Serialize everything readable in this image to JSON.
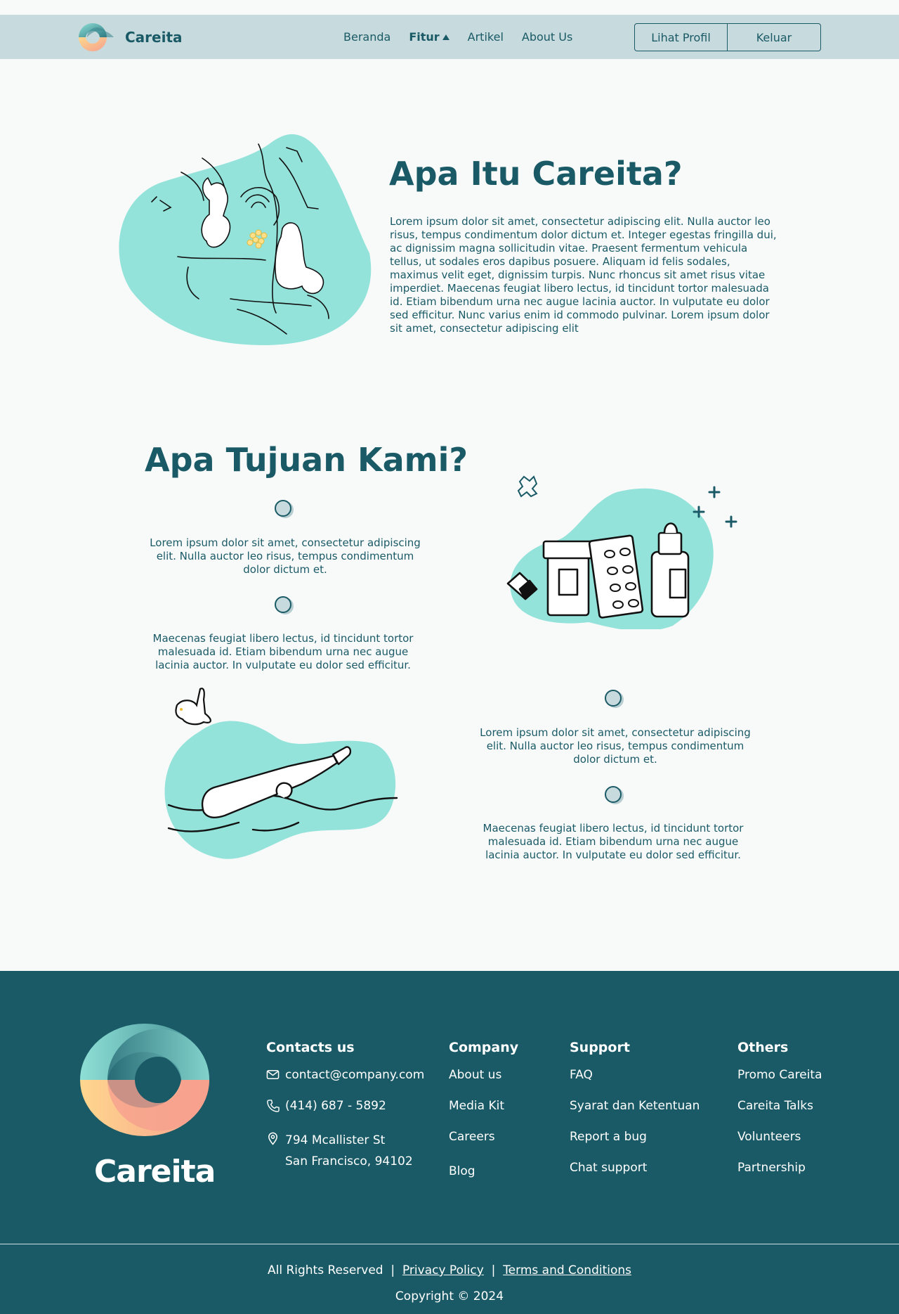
{
  "nav": {
    "brand": "Careita",
    "links": [
      "Beranda",
      "Fitur",
      "Artikel",
      "About Us"
    ],
    "profile_button": "Lihat Profil",
    "logout_button": "Keluar"
  },
  "about": {
    "title": "Apa Itu Careita?",
    "body": "Lorem ipsum dolor sit amet, consectetur adipiscing elit. Nulla auctor leo risus, tempus condimentum dolor dictum et. Integer egestas fringilla dui, ac dignissim magna sollicitudin vitae. Praesent fermentum vehicula tellus, ut sodales eros dapibus posuere. Aliquam id felis sodales, maximus velit eget, dignissim turpis. Nunc rhoncus sit amet risus vitae imperdiet. Maecenas feugiat libero lectus, id tincidunt tortor malesuada id. Etiam bibendum urna nec augue lacinia auctor. In vulputate eu dolor sed efficitur. Nunc varius enim id commodo pulvinar. Lorem ipsum dolor sit amet, consectetur adipiscing elit"
  },
  "goals": {
    "title": "Apa Tujuan Kami?",
    "left": [
      "Lorem ipsum dolor sit amet, consectetur adipiscing elit. Nulla auctor leo risus, tempus condimentum dolor dictum et.",
      "Maecenas feugiat libero lectus, id tincidunt tortor malesuada id. Etiam bibendum urna nec augue lacinia auctor. In vulputate eu dolor sed efficitur."
    ],
    "right": [
      "Lorem ipsum dolor sit amet, consectetur adipiscing elit. Nulla auctor leo risus, tempus condimentum dolor dictum et.",
      "Maecenas feugiat libero lectus, id tincidunt tortor malesuada id. Etiam bibendum urna nec augue lacinia auctor. In vulputate eu dolor sed efficitur."
    ]
  },
  "footer": {
    "brand": "Careita",
    "contacts": {
      "heading": "Contacts us",
      "email": "contact@company.com",
      "phone": "(414) 687 - 5892",
      "address_line1": "794 Mcallister St",
      "address_line2": "San Francisco, 94102"
    },
    "company": {
      "heading": "Company",
      "items": [
        "About us",
        "Media Kit",
        "Careers",
        "Blog"
      ]
    },
    "support": {
      "heading": "Support",
      "items": [
        "FAQ",
        "Syarat dan Ketentuan",
        "Report a bug",
        "Chat support"
      ]
    },
    "others": {
      "heading": "Others",
      "items": [
        "Promo Careita",
        "Careita Talks",
        "Volunteers",
        "Partnership"
      ]
    },
    "rights": "All Rights Reserved",
    "privacy": "Privacy Policy",
    "terms": "Terms and Conditions",
    "copyright": "Copyright © 2024"
  },
  "colors": {
    "primary": "#1a5a66",
    "navbar": "#c7dadd",
    "accent_mint": "#94e3da",
    "background": "#f8fafa"
  }
}
